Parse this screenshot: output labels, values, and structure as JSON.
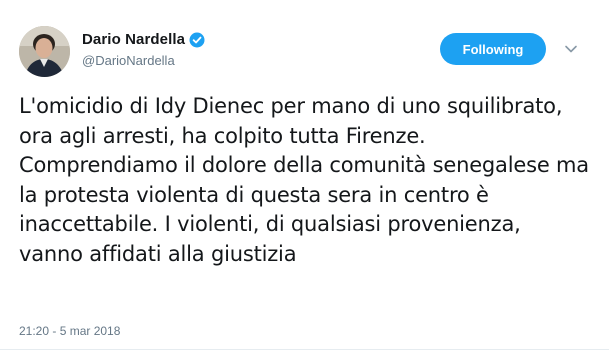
{
  "tweet": {
    "author": {
      "display_name": "Dario Nardella",
      "handle": "@DarioNardella",
      "verified": true,
      "avatar_icon": "user-avatar"
    },
    "follow_button": {
      "label": "Following"
    },
    "caret_icon": "chevron-down-icon",
    "text": "L'omicidio di Idy Dienec per mano di uno squilibrato, ora agli arresti, ha colpito tutta Firenze. Comprendiamo il dolore della comunità senegalese ma la protesta violenta di questa sera in centro è inaccettabile. I violenti, di qualsiasi provenienza, vanno affidati alla giustizia",
    "timestamp": "21:20 - 5 mar 2018"
  },
  "colors": {
    "accent": "#1da1f2",
    "text": "#14171a",
    "secondary_text": "#657786",
    "divider": "#e6ecf0"
  }
}
